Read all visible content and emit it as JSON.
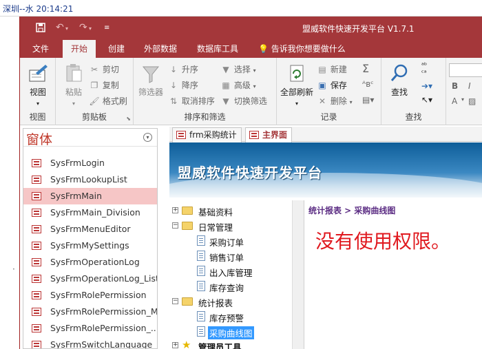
{
  "outer": {
    "status_text": "深圳--水  20:14:21"
  },
  "app": {
    "title": "盟威软件快速开发平台 V1.7.1",
    "quick_access": {
      "save_icon": "save-icon",
      "undo_icon": "undo-icon",
      "redo_icon": "redo-icon",
      "customize_icon": "customize-icon"
    },
    "tabs": [
      "文件",
      "开始",
      "创建",
      "外部数据",
      "数据库工具"
    ],
    "active_tab": "开始",
    "tell_me": "告诉我你想要做什么"
  },
  "ribbon": {
    "view": {
      "label": "视图",
      "group": "视图"
    },
    "clipboard": {
      "paste": "粘贴",
      "cut": "剪切",
      "copy": "复制",
      "format_painter": "格式刷",
      "group": "剪贴板"
    },
    "sort_filter": {
      "filter": "筛选器",
      "asc": "升序",
      "desc": "降序",
      "clear_sort": "取消排序",
      "select": "选择",
      "advanced": "高级",
      "toggle_filter": "切换筛选",
      "group": "排序和筛选"
    },
    "records": {
      "refresh_all": "全部刷新",
      "new": "新建",
      "save": "保存",
      "delete": "删除",
      "sigma": "Σ",
      "group": "记录"
    },
    "find": {
      "find": "查找",
      "group": "查找"
    },
    "text": {
      "bold": "B",
      "italic": "I",
      "font_a": "A"
    }
  },
  "navpane": {
    "title": "窗体",
    "items": [
      "SysFrmLogin",
      "SysFrmLookupList",
      "SysFrmMain",
      "SysFrmMain_Division",
      "SysFrmMenuEditor",
      "SysFrmMySettings",
      "SysFrmOperationLog",
      "SysFrmOperationLog_List",
      "SysFrmRolePermission",
      "SysFrmRolePermission_M",
      "SysFrmRolePermission_...",
      "SysFrmSwitchLanguage"
    ],
    "selected": "SysFrmMain"
  },
  "doctabs": [
    {
      "label": "frm采购统计",
      "active": false
    },
    {
      "label": "主界面",
      "active": true
    }
  ],
  "mainform": {
    "banner_title": "盟威软件快速开发平台",
    "tree": [
      {
        "label": "基础资料",
        "level": 0,
        "type": "folder",
        "expander": "+"
      },
      {
        "label": "日常管理",
        "level": 0,
        "type": "folder-open",
        "expander": "−"
      },
      {
        "label": "采购订单",
        "level": 1,
        "type": "doc"
      },
      {
        "label": "销售订单",
        "level": 1,
        "type": "doc"
      },
      {
        "label": "出入库管理",
        "level": 1,
        "type": "doc"
      },
      {
        "label": "库存查询",
        "level": 1,
        "type": "doc"
      },
      {
        "label": "统计报表",
        "level": 0,
        "type": "folder-open",
        "expander": "−"
      },
      {
        "label": "库存预警",
        "level": 1,
        "type": "doc"
      },
      {
        "label": "采购曲线图",
        "level": 1,
        "type": "doc",
        "selected": true
      },
      {
        "label": "管理员工具",
        "level": 0,
        "type": "star",
        "expander": "+"
      }
    ],
    "breadcrumb": "统计报表 > 采购曲线图",
    "message": "没有使用权限。"
  }
}
